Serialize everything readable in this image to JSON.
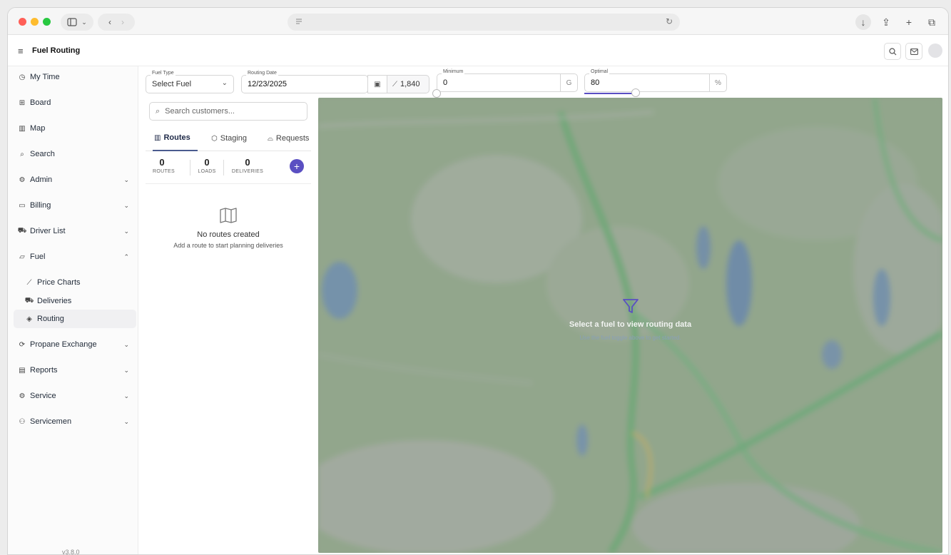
{
  "app": {
    "title": "Fuel Routing",
    "version": "v3.8.0"
  },
  "sidebar": {
    "items": [
      {
        "label": "My Time",
        "icon": "clock-icon",
        "has_chevron": false
      },
      {
        "label": "Board",
        "icon": "grid-icon",
        "has_chevron": false
      },
      {
        "label": "Map",
        "icon": "map-icon",
        "has_chevron": false
      },
      {
        "label": "Search",
        "icon": "search-icon",
        "has_chevron": false
      },
      {
        "label": "Admin",
        "icon": "gear-icon",
        "has_chevron": true
      },
      {
        "label": "Billing",
        "icon": "wallet-icon",
        "has_chevron": true
      },
      {
        "label": "Driver List",
        "icon": "car-icon",
        "has_chevron": true
      },
      {
        "label": "Fuel",
        "icon": "folder-icon",
        "has_chevron": true,
        "expanded": true
      },
      {
        "label": "Price Charts",
        "icon": "chart-line-icon",
        "sub": true
      },
      {
        "label": "Deliveries",
        "icon": "truck-icon",
        "sub": true
      },
      {
        "label": "Routing",
        "icon": "route-icon",
        "sub": true,
        "active": true
      },
      {
        "label": "Propane Exchange",
        "icon": "refresh-icon",
        "has_chevron": true
      },
      {
        "label": "Reports",
        "icon": "bar-chart-icon",
        "has_chevron": true
      },
      {
        "label": "Service",
        "icon": "gear-icon",
        "has_chevron": true
      },
      {
        "label": "Servicemen",
        "icon": "users-icon",
        "has_chevron": true
      }
    ]
  },
  "filters": {
    "fuel_type": {
      "label": "Fuel Type",
      "value": "Select Fuel"
    },
    "routing_date": {
      "label": "Routing Date",
      "value": "12/23/2025"
    },
    "trend_value": "1,840",
    "minimum": {
      "label": "Minimum",
      "value": "0",
      "suffix": "G",
      "level": 0
    },
    "optimal": {
      "label": "Optimal",
      "value": "80",
      "suffix": "%",
      "level": 0.8
    }
  },
  "panel": {
    "search_placeholder": "Search customers...",
    "tabs": [
      {
        "label": "Routes",
        "icon": "map-icon",
        "active": true
      },
      {
        "label": "Staging",
        "icon": "box-icon"
      },
      {
        "label": "Requests",
        "icon": "inbox-icon"
      }
    ],
    "stats": [
      {
        "value": "0",
        "label": "ROUTES"
      },
      {
        "value": "0",
        "label": "LOADS"
      },
      {
        "value": "0",
        "label": "DELIVERIES"
      }
    ],
    "empty_title": "No routes created",
    "empty_subtitle": "Add a route to start planning deliveries"
  },
  "map": {
    "message_title": "Select a fuel to view routing data",
    "message_subtitle": "Use the fuel toggle above to get started."
  },
  "colors": {
    "accent": "#5a4fc2",
    "map_green": "#95aa8f"
  }
}
